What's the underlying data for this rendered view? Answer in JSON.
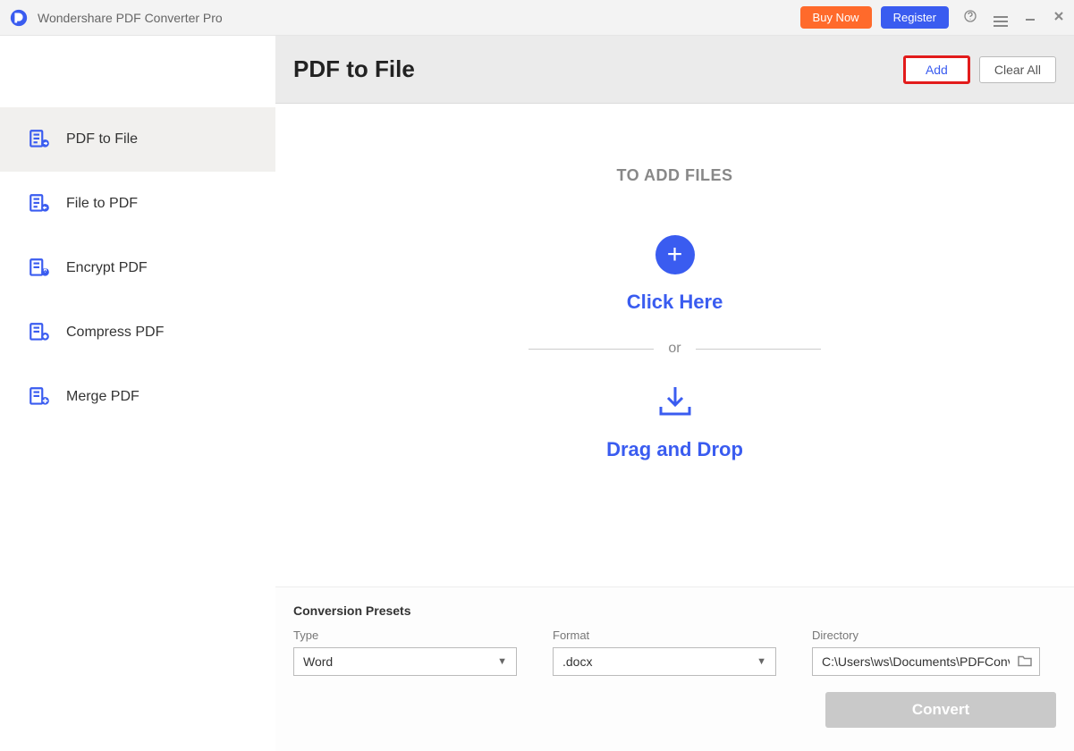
{
  "titlebar": {
    "app_name": "Wondershare PDF Converter Pro",
    "buy_label": "Buy Now",
    "register_label": "Register"
  },
  "sidebar": {
    "items": [
      {
        "label": "PDF to File"
      },
      {
        "label": "File to PDF"
      },
      {
        "label": "Encrypt PDF"
      },
      {
        "label": "Compress PDF"
      },
      {
        "label": "Merge PDF"
      }
    ]
  },
  "header": {
    "title": "PDF to File",
    "add_label": "Add",
    "clear_label": "Clear All"
  },
  "content": {
    "to_add": "TO ADD FILES",
    "click_here": "Click Here",
    "or_label": "or",
    "drag_drop": "Drag and Drop"
  },
  "presets": {
    "title": "Conversion Presets",
    "type_label": "Type",
    "type_value": "Word",
    "format_label": "Format",
    "format_value": ".docx",
    "directory_label": "Directory",
    "directory_value": "C:\\Users\\ws\\Documents\\PDFConvert",
    "convert_label": "Convert"
  }
}
